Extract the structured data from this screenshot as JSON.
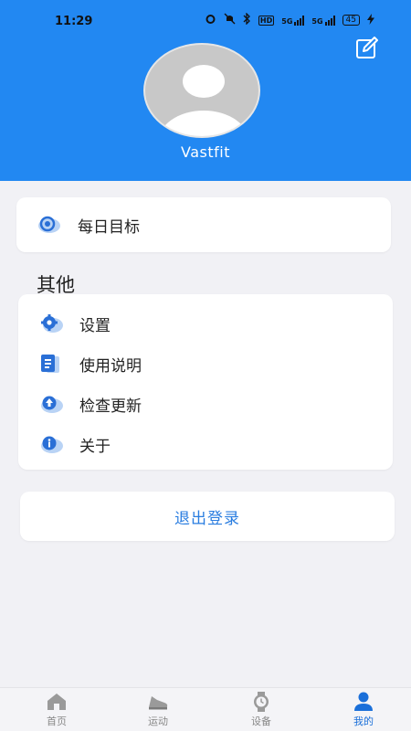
{
  "status_bar": {
    "time": "11:29",
    "net_label_1": "5G",
    "net_label_2": "5G",
    "hd_label": "HD",
    "battery": "45"
  },
  "profile": {
    "username": "Vastfit",
    "edit_icon": "edit-icon",
    "avatar_icon": "default-avatar"
  },
  "goal_card": {
    "items": [
      {
        "label": "每日目标",
        "icon": "target-icon"
      }
    ]
  },
  "other_section": {
    "title": "其他",
    "items": [
      {
        "label": "设置",
        "icon": "gear-icon"
      },
      {
        "label": "使用说明",
        "icon": "manual-icon"
      },
      {
        "label": "检查更新",
        "icon": "update-icon"
      },
      {
        "label": "关于",
        "icon": "info-icon"
      }
    ]
  },
  "logout": {
    "label": "退出登录"
  },
  "tabbar": {
    "tabs": [
      {
        "label": "首页",
        "icon": "home-icon",
        "active": false
      },
      {
        "label": "运动",
        "icon": "shoe-icon",
        "active": false
      },
      {
        "label": "设备",
        "icon": "watch-icon",
        "active": false
      },
      {
        "label": "我的",
        "icon": "person-icon",
        "active": true
      }
    ]
  },
  "colors": {
    "header_blue": "#2288f2",
    "accent_blue": "#1a6fd9",
    "background": "#f1f1f5"
  }
}
